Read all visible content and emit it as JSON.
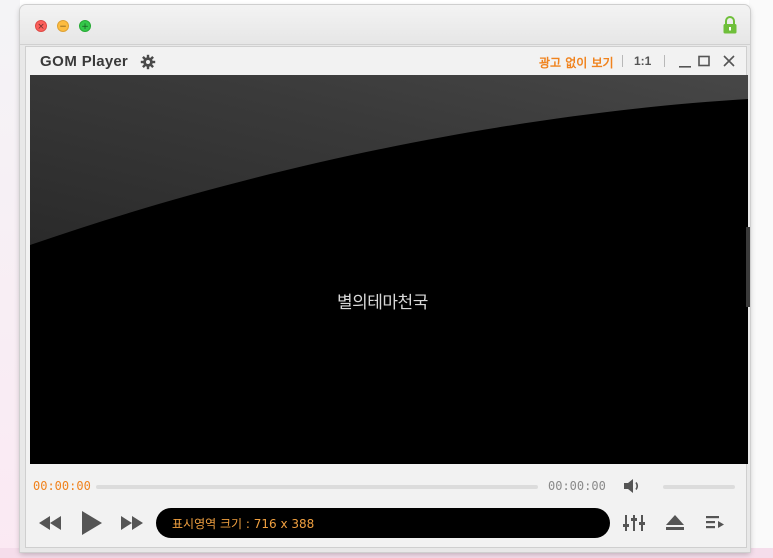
{
  "window": {
    "traffic_close_glyph": "×",
    "traffic_min_glyph": "−",
    "traffic_max_glyph": "+"
  },
  "header": {
    "logo_gom": "GOM",
    "logo_player": "Player",
    "no_ads_label": "광고 없이 보기",
    "ratio_label": "1:1"
  },
  "video": {
    "watermark": "별의테마천국"
  },
  "seekbar": {
    "current_time": "00:00:00",
    "total_time": "00:00:00"
  },
  "status": {
    "text": "표시영역 크기 : 716 x 388"
  },
  "icons": {
    "gear": "gear-icon",
    "lock": "lock-icon",
    "minimize": "minimize-icon",
    "maximize": "maximize-icon",
    "close": "close-icon",
    "volume": "volume-icon",
    "prev": "rewind-icon",
    "play": "play-icon",
    "next": "fast-forward-icon",
    "equalizer": "equalizer-icon",
    "eject": "eject-icon",
    "playlist": "playlist-icon"
  },
  "colors": {
    "accent_orange": "#f0831e",
    "video_bg": "#000000",
    "status_text": "#f0a040"
  }
}
